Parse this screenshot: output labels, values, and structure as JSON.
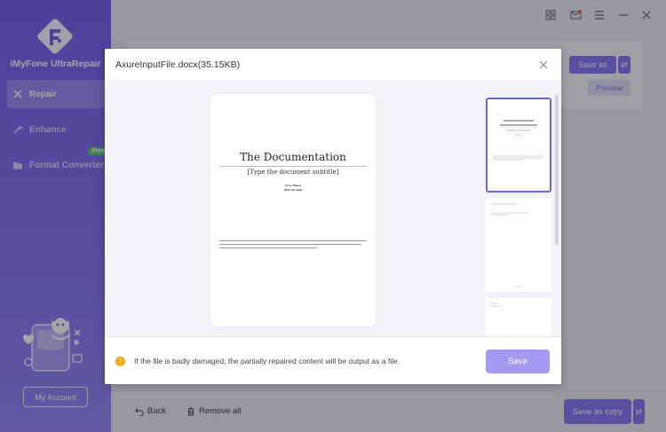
{
  "app": {
    "name": "iMyFone UltraRepair"
  },
  "sidebar": {
    "items": [
      {
        "label": "Repair",
        "icon": "repair-icon"
      },
      {
        "label": "Enhance",
        "icon": "wand-icon"
      },
      {
        "label": "Format Converter",
        "icon": "folder-icon",
        "badge": "Free"
      }
    ],
    "account_label": "My Account"
  },
  "background": {
    "save_as_label": "Save as",
    "preview_label": "Preview",
    "back_label": "Back",
    "remove_all_label": "Remove all",
    "save_as_copy_label": "Save as copy",
    "swap_glyph": "⇄"
  },
  "dialog": {
    "title": "AxureInputFile.docx(35.15KB)",
    "document": {
      "title": "The Documentation",
      "subtitle": "[Type the document subtitle]",
      "author": "[User Name]",
      "date": "[Pick the date]"
    },
    "notice": "If the file is badly damaged, the partially repaired content will be output as a file.",
    "save_label": "Save",
    "notice_icon": "!"
  },
  "colors": {
    "accent": "#7b6bf0",
    "sidebar_top": "#6a53e6",
    "warning": "#f5a623",
    "badge": "#4bc06a"
  }
}
